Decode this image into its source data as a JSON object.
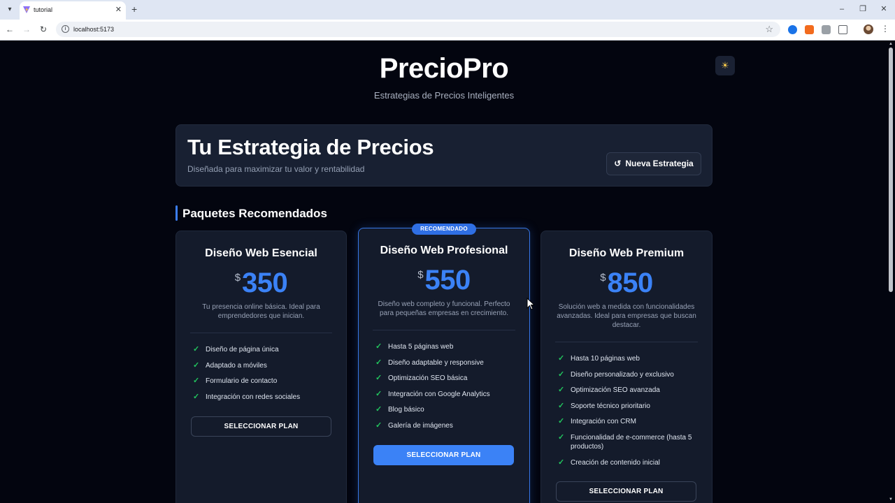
{
  "browser": {
    "tab_title": "tutorial",
    "url": "localhost:5173"
  },
  "header": {
    "brand": "PrecioPro",
    "tagline": "Estrategias de Precios Inteligentes"
  },
  "hero": {
    "title": "Tu Estrategia de Precios",
    "subtitle": "Diseñada para maximizar tu valor y rentabilidad",
    "new_button": "Nueva Estrategia"
  },
  "section": {
    "title": "Paquetes Recomendados"
  },
  "plans": [
    {
      "name": "Diseño Web Esencial",
      "currency": "$",
      "price": "350",
      "description": "Tu presencia online básica. Ideal para emprendedores que inician.",
      "features": [
        "Diseño de página única",
        "Adaptado a móviles",
        "Formulario de contacto",
        "Integración con redes sociales"
      ],
      "button": "SELECCIONAR PLAN"
    },
    {
      "badge": "RECOMENDADO",
      "name": "Diseño Web Profesional",
      "currency": "$",
      "price": "550",
      "description": "Diseño web completo y funcional. Perfecto para pequeñas empresas en crecimiento.",
      "features": [
        "Hasta 5 páginas web",
        "Diseño adaptable y responsive",
        "Optimización SEO básica",
        "Integración con Google Analytics",
        "Blog básico",
        "Galería de imágenes"
      ],
      "button": "SELECCIONAR PLAN"
    },
    {
      "name": "Diseño Web Premium",
      "currency": "$",
      "price": "850",
      "description": "Solución web a medida con funcionalidades avanzadas. Ideal para empresas que buscan destacar.",
      "features": [
        "Hasta 10 páginas web",
        "Diseño personalizado y exclusivo",
        "Optimización SEO avanzada",
        "Soporte técnico prioritario",
        "Integración con CRM",
        "Funcionalidad de e-commerce (hasta 5 productos)",
        "Creación de contenido inicial"
      ],
      "button": "SELECCIONAR PLAN"
    }
  ],
  "icons": {
    "theme_toggle": "sun-icon",
    "new_button": "reset-icon",
    "feature": "check-icon"
  },
  "colors": {
    "background": "#03050f",
    "card": "#141b2b",
    "accent": "#3b82f6",
    "check": "#22c55e"
  }
}
